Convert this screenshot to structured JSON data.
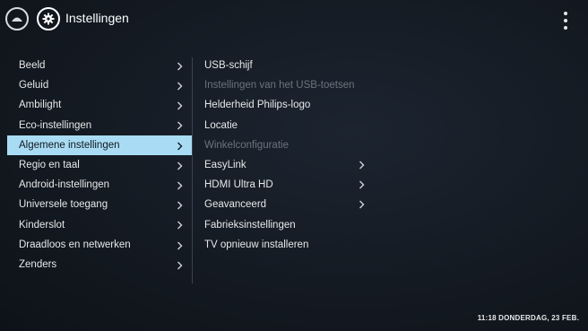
{
  "header": {
    "title": "Instellingen",
    "icons": {
      "home": "home-icon",
      "settings": "gear-icon",
      "more": "more-vertical-icon"
    }
  },
  "left_menu": {
    "items": [
      {
        "label": "Beeld",
        "selected": false
      },
      {
        "label": "Geluid",
        "selected": false
      },
      {
        "label": "Ambilight",
        "selected": false
      },
      {
        "label": "Eco-instellingen",
        "selected": false
      },
      {
        "label": "Algemene instellingen",
        "selected": true
      },
      {
        "label": "Regio en taal",
        "selected": false
      },
      {
        "label": "Android-instellingen",
        "selected": false
      },
      {
        "label": "Universele toegang",
        "selected": false
      },
      {
        "label": "Kinderslot",
        "selected": false
      },
      {
        "label": "Draadloos en netwerken",
        "selected": false
      },
      {
        "label": "Zenders",
        "selected": false
      }
    ]
  },
  "right_menu": {
    "items": [
      {
        "label": "USB-schijf",
        "disabled": false,
        "has_submenu": false
      },
      {
        "label": "Instellingen van het USB-toetsenbord",
        "disabled": true,
        "has_submenu": false
      },
      {
        "label": "Helderheid Philips-logo",
        "disabled": false,
        "has_submenu": false
      },
      {
        "label": "Locatie",
        "disabled": false,
        "has_submenu": false
      },
      {
        "label": "Winkelconfiguratie",
        "disabled": true,
        "has_submenu": false
      },
      {
        "label": "EasyLink",
        "disabled": false,
        "has_submenu": true
      },
      {
        "label": "HDMI Ultra HD",
        "disabled": false,
        "has_submenu": true
      },
      {
        "label": "Geavanceerd",
        "disabled": false,
        "has_submenu": true
      },
      {
        "label": "Fabrieksinstellingen",
        "disabled": false,
        "has_submenu": false
      },
      {
        "label": "TV opnieuw installeren",
        "disabled": false,
        "has_submenu": false
      }
    ]
  },
  "status": {
    "datetime": "11:18 DONDERDAG, 23 FEB."
  },
  "colors": {
    "selected_bg": "#a9dcf4",
    "disabled_text": "#6b737d",
    "text": "#e6e8ea"
  }
}
